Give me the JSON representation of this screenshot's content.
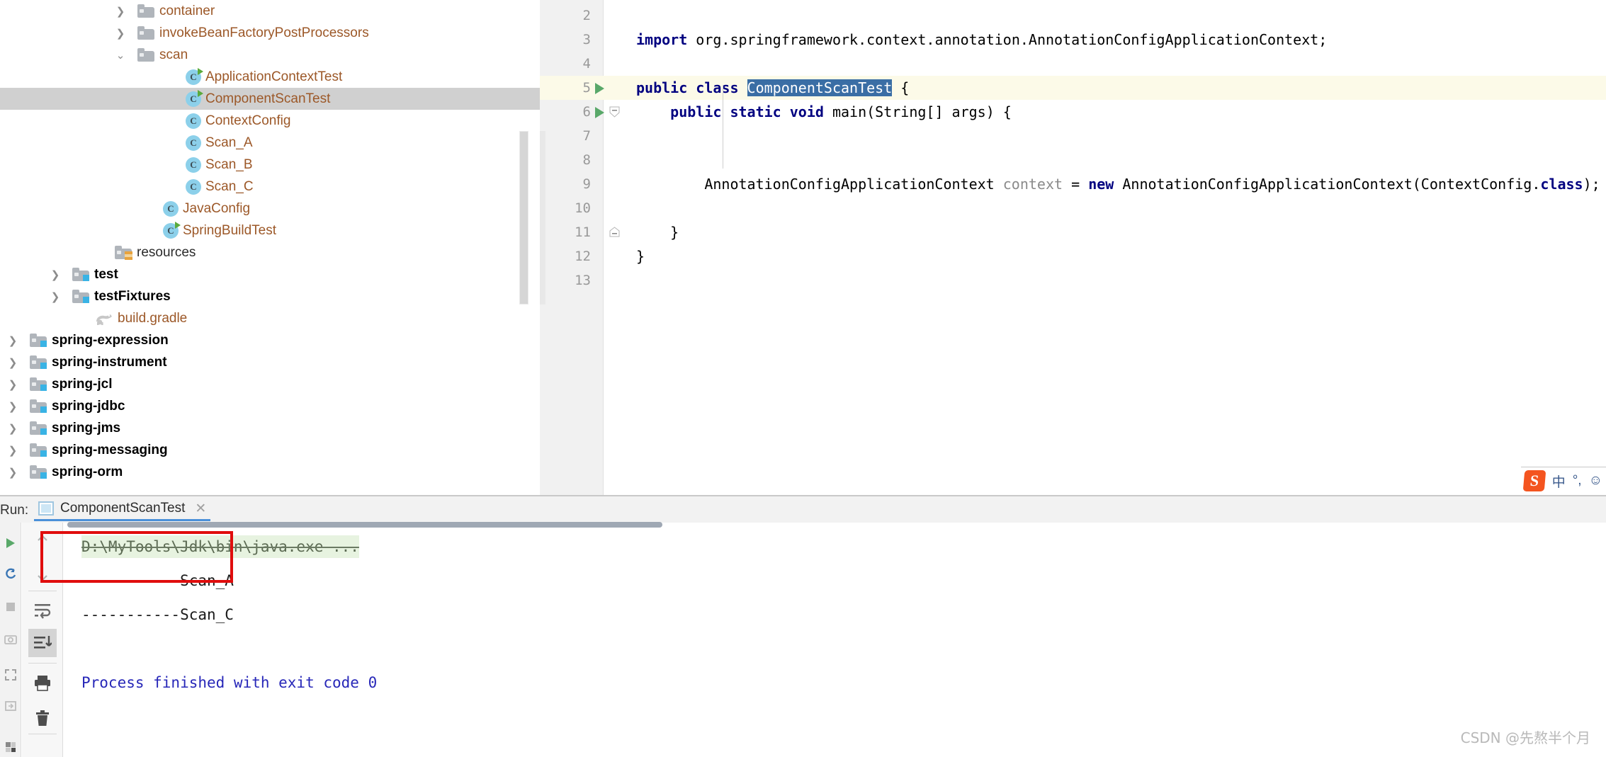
{
  "project_tree": {
    "items": [
      {
        "id": "container",
        "label": "container",
        "indent": 160,
        "arrow": "chevron-right",
        "icon": "folder",
        "style": "path"
      },
      {
        "id": "invokeBeanFactoryPostProcessors",
        "label": "invokeBeanFactoryPostProcessors",
        "indent": 160,
        "arrow": "chevron-right",
        "icon": "folder",
        "style": "path"
      },
      {
        "id": "scan",
        "label": "scan",
        "indent": 160,
        "arrow": "chevron-down",
        "icon": "folder",
        "style": "path"
      },
      {
        "id": "ApplicationContextTest",
        "label": "ApplicationContextTest",
        "indent": 228,
        "arrow": "none",
        "icon": "class-runnable",
        "style": "path"
      },
      {
        "id": "ComponentScanTest",
        "label": "ComponentScanTest",
        "indent": 228,
        "arrow": "none",
        "icon": "class-runnable",
        "style": "path",
        "selected": true
      },
      {
        "id": "ContextConfig",
        "label": "ContextConfig",
        "indent": 228,
        "arrow": "none",
        "icon": "class",
        "style": "path"
      },
      {
        "id": "Scan_A",
        "label": "Scan_A",
        "indent": 228,
        "arrow": "none",
        "icon": "class",
        "style": "path"
      },
      {
        "id": "Scan_B",
        "label": "Scan_B",
        "indent": 228,
        "arrow": "none",
        "icon": "class",
        "style": "path"
      },
      {
        "id": "Scan_C",
        "label": "Scan_C",
        "indent": 228,
        "arrow": "none",
        "icon": "class",
        "style": "path"
      },
      {
        "id": "JavaConfig",
        "label": "JavaConfig",
        "indent": 196,
        "arrow": "none",
        "icon": "class",
        "style": "path"
      },
      {
        "id": "SpringBuildTest",
        "label": "SpringBuildTest",
        "indent": 196,
        "arrow": "none",
        "icon": "class-runnable",
        "style": "path"
      },
      {
        "id": "resources",
        "label": "resources",
        "indent": 128,
        "arrow": "none",
        "icon": "folder-resources",
        "style": "plain"
      },
      {
        "id": "test",
        "label": "test",
        "indent": 68,
        "arrow": "chevron-right",
        "icon": "folder-source",
        "style": "bold"
      },
      {
        "id": "testFixtures",
        "label": "testFixtures",
        "indent": 68,
        "arrow": "chevron-right",
        "icon": "folder-source",
        "style": "bold"
      },
      {
        "id": "build.gradle",
        "label": "build.gradle",
        "indent": 100,
        "arrow": "none",
        "icon": "gradle",
        "style": "path"
      },
      {
        "id": "spring-expression",
        "label": "spring-expression",
        "indent": 8,
        "arrow": "chevron-right",
        "icon": "folder-source",
        "style": "bold"
      },
      {
        "id": "spring-instrument",
        "label": "spring-instrument",
        "indent": 8,
        "arrow": "chevron-right",
        "icon": "folder-source",
        "style": "bold"
      },
      {
        "id": "spring-jcl",
        "label": "spring-jcl",
        "indent": 8,
        "arrow": "chevron-right",
        "icon": "folder-source",
        "style": "bold"
      },
      {
        "id": "spring-jdbc",
        "label": "spring-jdbc",
        "indent": 8,
        "arrow": "chevron-right",
        "icon": "folder-source",
        "style": "bold"
      },
      {
        "id": "spring-jms",
        "label": "spring-jms",
        "indent": 8,
        "arrow": "chevron-right",
        "icon": "folder-source",
        "style": "bold"
      },
      {
        "id": "spring-messaging",
        "label": "spring-messaging",
        "indent": 8,
        "arrow": "chevron-right",
        "icon": "folder-source",
        "style": "bold"
      },
      {
        "id": "spring-orm",
        "label": "spring-orm",
        "indent": 8,
        "arrow": "chevron-right",
        "icon": "folder-source",
        "style": "bold"
      }
    ]
  },
  "editor": {
    "lines": [
      {
        "num": "2",
        "segments": []
      },
      {
        "num": "3",
        "segments": [
          {
            "t": "import ",
            "c": "kw"
          },
          {
            "t": "org.springframework.context.annotation.AnnotationConfigApplicationContext;",
            "c": ""
          }
        ]
      },
      {
        "num": "4",
        "segments": []
      },
      {
        "num": "5",
        "current": true,
        "run": true,
        "segments": [
          {
            "t": "public class ",
            "c": "kw"
          },
          {
            "t": "ComponentScanTest",
            "c": "sel"
          },
          {
            "t": " {",
            "c": ""
          }
        ]
      },
      {
        "num": "6",
        "run": true,
        "fold": "open",
        "segments": [
          {
            "t": "    public static void ",
            "c": "kw"
          },
          {
            "t": "main(String[] args) {",
            "c": ""
          }
        ]
      },
      {
        "num": "7",
        "segments": []
      },
      {
        "num": "8",
        "segments": []
      },
      {
        "num": "9",
        "segments": [
          {
            "t": "        AnnotationConfigApplicationContext ",
            "c": ""
          },
          {
            "t": "context",
            "c": "lvar"
          },
          {
            "t": " = ",
            "c": ""
          },
          {
            "t": "new ",
            "c": "kw"
          },
          {
            "t": "AnnotationConfigApplicationContext(ContextConfig.",
            "c": ""
          },
          {
            "t": "class",
            "c": "kw"
          },
          {
            "t": ");",
            "c": ""
          }
        ]
      },
      {
        "num": "10",
        "segments": []
      },
      {
        "num": "11",
        "fold": "closed",
        "segments": [
          {
            "t": "    }",
            "c": ""
          }
        ]
      },
      {
        "num": "12",
        "segments": [
          {
            "t": "}",
            "c": ""
          }
        ]
      },
      {
        "num": "13",
        "segments": []
      }
    ]
  },
  "ime": {
    "logo": "S",
    "items": [
      "中",
      "°,",
      "☺"
    ]
  },
  "run_panel": {
    "label": "Run:",
    "tab_title": "ComponentScanTest",
    "close": "✕",
    "console_lines": [
      {
        "text": "D:\\MyTools\\Jdk\\bin\\java.exe ...",
        "kind": "cmd"
      },
      {
        "text": "-----------Scan_A",
        "kind": "out"
      },
      {
        "text": "-----------Scan_C",
        "kind": "out"
      },
      {
        "text": "",
        "kind": "out"
      },
      {
        "text": "Process finished with exit code 0",
        "kind": "fin"
      }
    ],
    "tool_icons": [
      {
        "name": "scroll-up-icon",
        "glyph": "↑"
      },
      {
        "name": "scroll-down-icon",
        "glyph": "↓"
      },
      {
        "name": "soft-wrap-icon",
        "glyph": "wrap"
      },
      {
        "name": "scroll-to-end-icon",
        "glyph": "end"
      },
      {
        "name": "print-icon",
        "glyph": "print"
      },
      {
        "name": "trash-icon",
        "glyph": "trash"
      }
    ],
    "left_icons": [
      {
        "name": "run-icon",
        "glyph": "▶"
      },
      {
        "name": "rerun-icon",
        "glyph": "↻"
      },
      {
        "name": "stop-icon",
        "glyph": "■"
      },
      {
        "name": "camera-icon",
        "glyph": "◎"
      },
      {
        "name": "expand-icon",
        "glyph": "⤢"
      },
      {
        "name": "collapse-icon",
        "glyph": "⊡"
      },
      {
        "name": "settings-icon",
        "glyph": "▤"
      }
    ]
  },
  "watermark": "CSDN @先熬半个月",
  "colors": {
    "selection_row": "#d0d0d0",
    "current_line": "#fcfae8",
    "token_selection": "#3a6ea5",
    "keyword": "#000080",
    "path_text": "#9c5828",
    "console_finish": "#2727b8",
    "red_box": "#e00d0d",
    "tab_underline": "#4a90d9"
  }
}
